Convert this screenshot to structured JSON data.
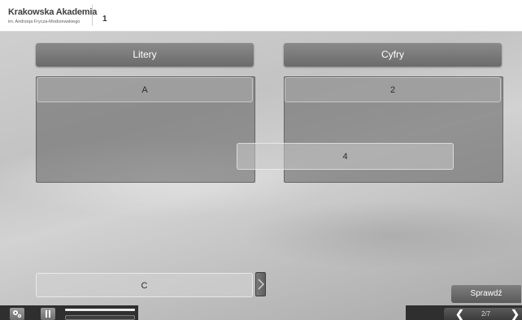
{
  "header": {
    "logo_name": "Krakowska Akademia",
    "logo_sub": "im. Andrzeja Frycza-Modrzewskiego",
    "page_number": "1"
  },
  "categories": [
    {
      "label": "Litery",
      "items": [
        "A"
      ]
    },
    {
      "label": "Cyfry",
      "items": [
        "2"
      ]
    }
  ],
  "dragging_item": "4",
  "pool_item": "C",
  "check_button": "Sprawdź",
  "navigation": {
    "prev_icon": "chevron-left-icon",
    "next_icon": "chevron-right-icon",
    "counter": "2/7"
  },
  "toolbar": {
    "settings_icon": "settings-icon",
    "pause_icon": "pause-icon"
  },
  "colors": {
    "header_bg": "#ffffff",
    "category_header": "#7a7a7a",
    "toolbar_bg": "#2f2f2f"
  }
}
